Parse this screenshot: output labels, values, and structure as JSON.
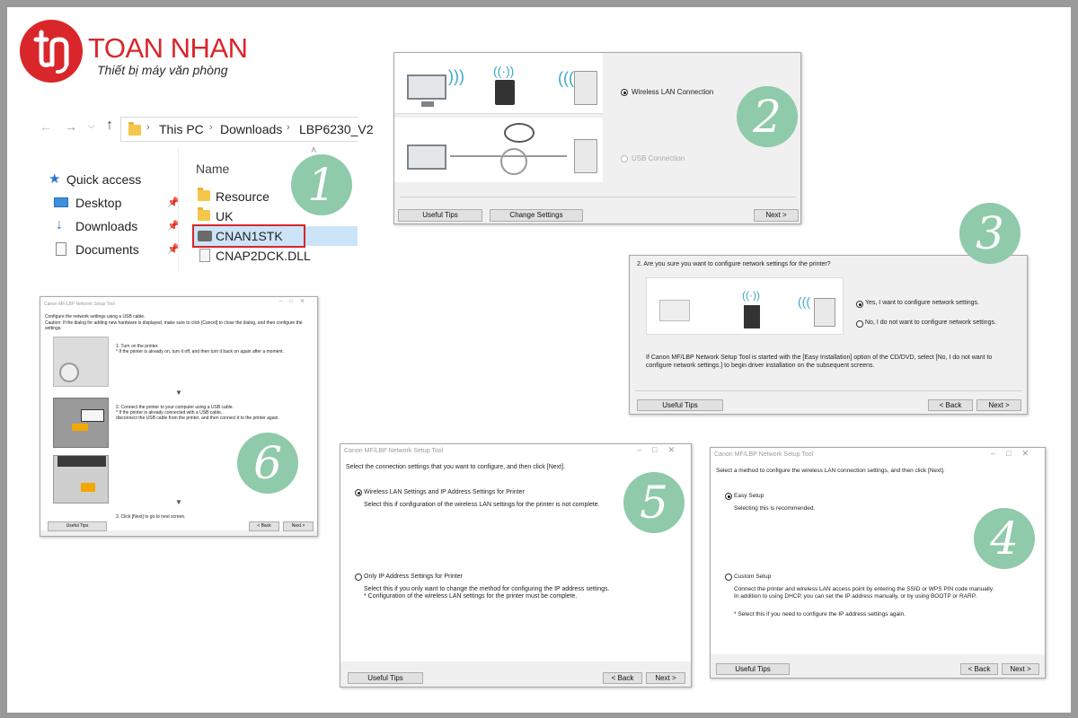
{
  "logo": {
    "name": "TOAN NHAN",
    "tagline": "Thiết bị máy văn phòng"
  },
  "colors": {
    "brand": "#d9262b",
    "badge": "#8fcaaa",
    "frame": "#9a9a9a",
    "selection": "#cce4f7"
  },
  "badges": [
    "1",
    "2",
    "3",
    "4",
    "5",
    "6"
  ],
  "panel1": {
    "breadcrumb": [
      "This PC",
      "Downloads",
      "LBP6230_V2"
    ],
    "quick_access": "Quick access",
    "nav_items": [
      "Desktop",
      "Downloads",
      "Documents"
    ],
    "column_header": "Name",
    "files": [
      "Resource",
      "UK",
      "CNAN1STK",
      "CNAP2DCK.DLL"
    ],
    "selected_file": "CNAN1STK"
  },
  "panel2": {
    "option_wireless": "Wireless LAN Connection",
    "option_usb": "USB Connection",
    "btn_tips": "Useful Tips",
    "btn_change": "Change Settings",
    "btn_next": "Next >"
  },
  "panel3": {
    "question": "2. Are you sure you want to configure network settings for the printer?",
    "option_yes": "Yes, I want to configure network settings.",
    "option_no": "No, I do not want to configure network settings.",
    "note_line1": "If Canon MF/LBP Network Setup Tool is started with the [Easy Installation] option of the CD/DVD, select [No, I do not want to",
    "note_line2": "configure network settings.] to begin driver installation on the subsequent screens.",
    "btn_tips": "Useful Tips",
    "btn_back": "< Back",
    "btn_next": "Next >"
  },
  "panel4": {
    "title": "Canon MF/LBP Network Setup Tool",
    "instruction": "Select a method to configure the wireless LAN connection settings, and then click [Next].",
    "option_easy": "Easy Setup",
    "easy_desc": "Selecting this is recommended.",
    "option_custom": "Custom Setup",
    "custom_desc1": "Connect the printer and wireless LAN access point by entering the SSID or WPS PIN code manually.",
    "custom_desc2": "In addition to using DHCP, you can set the IP address manually, or by using BOOTP or RARP.",
    "custom_note": "* Select this if you need to configure the IP address settings again.",
    "btn_tips": "Useful Tips",
    "btn_back": "< Back",
    "btn_next": "Next >"
  },
  "panel5": {
    "title": "Canon MF/LBP Network Setup Tool",
    "instruction": "Select the connection settings that you want to configure, and then click [Next].",
    "option_wireless": "Wireless LAN Settings and IP Address Settings for Printer",
    "wireless_desc": "Select this if configuration of the wireless LAN settings for the printer is not complete.",
    "option_ip": "Only IP Address Settings for Printer",
    "ip_desc1": "Select this if you only want to change the method for configuring the IP address settings.",
    "ip_desc2": "* Configuration of the wireless LAN settings for the printer must be complete.",
    "btn_tips": "Useful Tips",
    "btn_back": "< Back",
    "btn_next": "Next >"
  },
  "panel6": {
    "title": "Canon MF/LBP Network Setup Tool",
    "instruction1": "Configure the network settings using a USB cable.",
    "instruction2": "Caution: If the dialog for adding new hardware is displayed, make sure to click [Cancel] to close the dialog, and then configure the",
    "instruction3": "settings.",
    "step1a": "1. Turn on the printer.",
    "step1b": "* If the printer is already on, turn it off, and then turn it back on again after a moment.",
    "step2a": "2. Connect the printer to your computer using a USB cable.",
    "step2b": "* If the printer is already connected with a USB cable,",
    "step2c": "disconnect the USB cable from the printer, and then connect it to the printer again.",
    "step3": "3. Click [Next] to go to next screen.",
    "btn_tips": "Useful Tips",
    "btn_back": "< Back",
    "btn_next": "Next >"
  }
}
